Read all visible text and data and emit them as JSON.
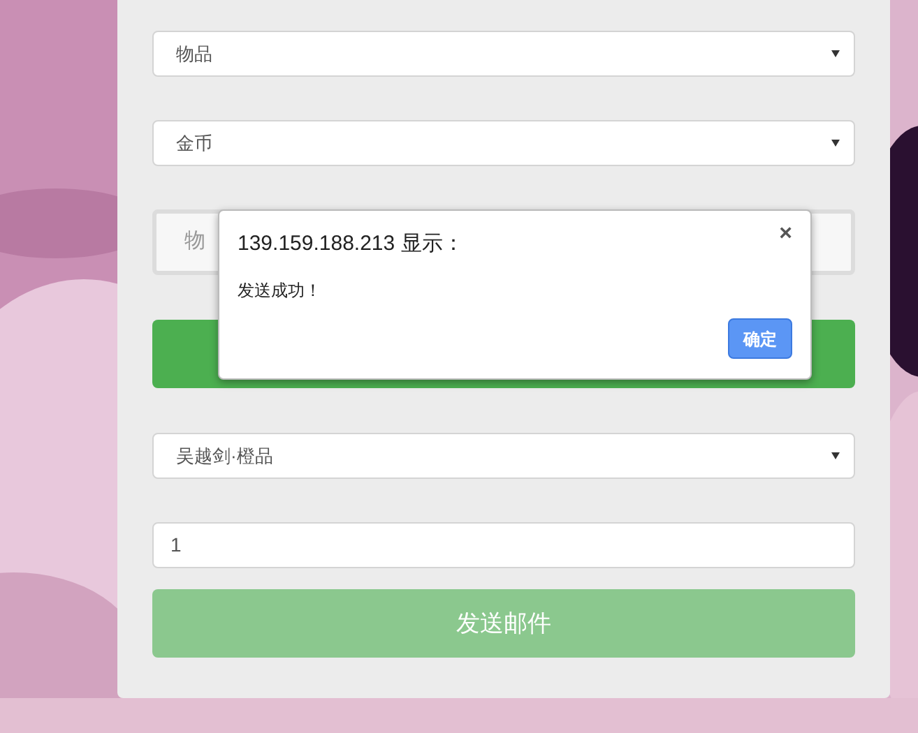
{
  "form": {
    "fields": [
      {
        "kind": "select",
        "value": "物品"
      },
      {
        "kind": "select",
        "value": "金币"
      },
      {
        "kind": "text",
        "value": "物",
        "disabled": true
      },
      {
        "kind": "button",
        "disabled": false
      },
      {
        "kind": "select",
        "value": "吴越剑·橙品"
      },
      {
        "kind": "text",
        "value": "1",
        "disabled": false
      },
      {
        "kind": "button",
        "label": "发送邮件",
        "disabled": true
      }
    ]
  },
  "dialog": {
    "title": "139.159.188.213 显示：",
    "close": "×",
    "message": "发送成功！",
    "ok_button": "确定"
  }
}
